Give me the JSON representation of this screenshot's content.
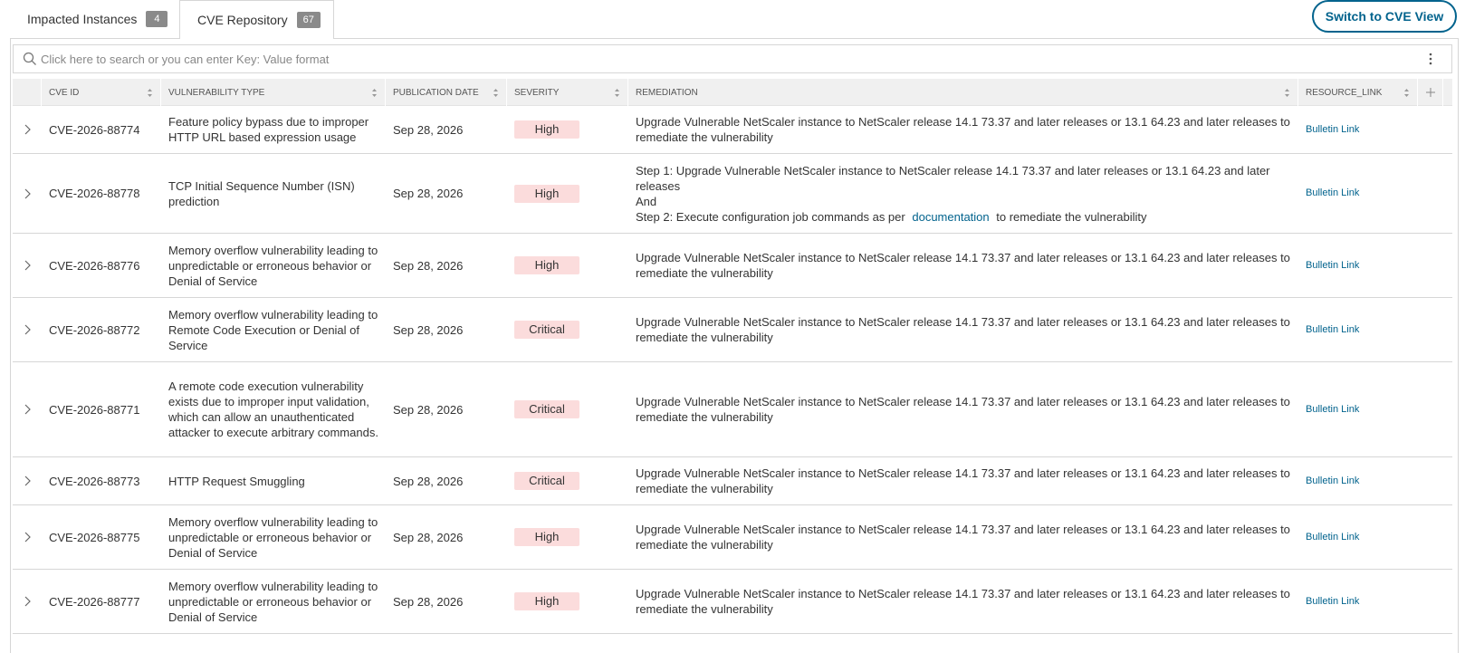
{
  "tabs": [
    {
      "label": "Impacted Instances",
      "count": "4"
    },
    {
      "label": "CVE Repository",
      "count": "67"
    }
  ],
  "switch_button_label": "Switch to CVE View",
  "search": {
    "placeholder": "Click here to search or you can enter Key: Value format"
  },
  "columns": {
    "cve_id": "CVE ID",
    "vulnerability_type": "VULNERABILITY TYPE",
    "publication_date": "PUBLICATION DATE",
    "severity": "SEVERITY",
    "remediation": "REMEDIATION",
    "resource_link": "RESOURCE_LINK"
  },
  "colors": {
    "accent": "#02638d",
    "severity_bg": "#fbdcdc",
    "header_bg": "#f0f0f0"
  },
  "rows": [
    {
      "cve_id": "CVE-2026-88774",
      "vulnerability_type": "Feature policy bypass due to improper HTTP URL based expression usage",
      "publication_date": "Sep 28, 2026",
      "severity": "High",
      "remediation": "Upgrade Vulnerable NetScaler instance to NetScaler release 14.1 73.37 and later releases or 13.1 64.23 and later releases to remediate the vulnerability",
      "resource_link": "Bulletin Link"
    },
    {
      "cve_id": "CVE-2026-88778",
      "vulnerability_type": "TCP Initial Sequence Number (ISN) prediction",
      "publication_date": "Sep 28, 2026",
      "severity": "High",
      "remediation_step1": "Step 1: Upgrade Vulnerable NetScaler instance to NetScaler release 14.1 73.37 and later releases or 13.1 64.23 and later releases",
      "remediation_and": "And",
      "remediation_step2_prefix": "Step 2: Execute configuration job commands as per",
      "remediation_step2_link": "documentation",
      "remediation_step2_suffix": "to remediate the vulnerability",
      "resource_link": "Bulletin Link"
    },
    {
      "cve_id": "CVE-2026-88776",
      "vulnerability_type": "Memory overflow vulnerability leading to unpredictable or erroneous behavior or Denial of Service",
      "publication_date": "Sep 28, 2026",
      "severity": "High",
      "remediation": "Upgrade Vulnerable NetScaler instance to NetScaler release 14.1 73.37 and later releases or 13.1 64.23 and later releases to remediate the vulnerability",
      "resource_link": "Bulletin Link"
    },
    {
      "cve_id": "CVE-2026-88772",
      "vulnerability_type": "Memory overflow vulnerability leading to Remote Code Execution or Denial of Service",
      "publication_date": "Sep 28, 2026",
      "severity": "Critical",
      "remediation": "Upgrade Vulnerable NetScaler instance to NetScaler release 14.1 73.37 and later releases or 13.1 64.23 and later releases to remediate the vulnerability",
      "resource_link": "Bulletin Link"
    },
    {
      "cve_id": "CVE-2026-88771",
      "vulnerability_type": "A remote code execution vulnerability exists due to improper input validation, which can allow an unauthenticated attacker to execute arbitrary commands.",
      "publication_date": "Sep 28, 2026",
      "severity": "Critical",
      "remediation": "Upgrade Vulnerable NetScaler instance to NetScaler release 14.1 73.37 and later releases or 13.1 64.23 and later releases to remediate the vulnerability",
      "resource_link": "Bulletin Link"
    },
    {
      "cve_id": "CVE-2026-88773",
      "vulnerability_type": "HTTP Request Smuggling",
      "publication_date": "Sep 28, 2026",
      "severity": "Critical",
      "remediation": "Upgrade Vulnerable NetScaler instance to NetScaler release 14.1 73.37 and later releases or 13.1 64.23 and later releases to remediate the vulnerability",
      "resource_link": "Bulletin Link"
    },
    {
      "cve_id": "CVE-2026-88775",
      "vulnerability_type": "Memory overflow vulnerability leading to unpredictable or erroneous behavior or Denial of Service",
      "publication_date": "Sep 28, 2026",
      "severity": "High",
      "remediation": "Upgrade Vulnerable NetScaler instance to NetScaler release 14.1 73.37 and later releases or 13.1 64.23 and later releases to remediate the vulnerability",
      "resource_link": "Bulletin Link"
    },
    {
      "cve_id": "CVE-2026-88777",
      "vulnerability_type": "Memory overflow vulnerability leading to unpredictable or erroneous behavior or Denial of Service",
      "publication_date": "Sep 28, 2026",
      "severity": "High",
      "remediation": "Upgrade Vulnerable NetScaler instance to NetScaler release 14.1 73.37 and later releases or 13.1 64.23 and later releases to remediate the vulnerability",
      "resource_link": "Bulletin Link"
    }
  ]
}
